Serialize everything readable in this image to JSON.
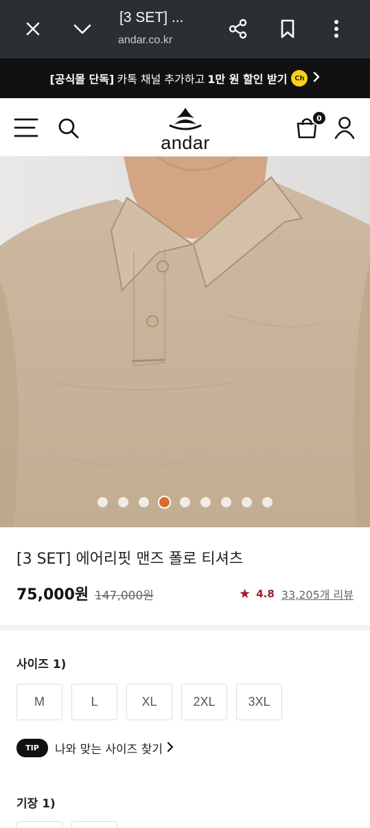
{
  "browser": {
    "title": "[3 SET] ...",
    "url": "andar.co.kr"
  },
  "promo": {
    "bold_prefix": "[공식몰 단독]",
    "normal_text": "카톡 채널 추가하고",
    "bold_suffix": "1만 원 할인 받기",
    "badge": "Ch"
  },
  "header": {
    "logo_text": "andar",
    "cart_count": "0"
  },
  "carousel": {
    "total": 9,
    "active_index": 3
  },
  "product": {
    "title": "[3 SET] 에어리핏 맨즈 폴로 티셔츠",
    "price": "75,000원",
    "original_price": "147,000원",
    "rating": "4.8",
    "reviews": "33,205개 리뷰"
  },
  "options": {
    "size_label": "사이즈 1)",
    "sizes": [
      "M",
      "L",
      "XL",
      "2XL",
      "3XL"
    ],
    "tip_badge": "TIP",
    "tip_text": "나와 맞는 사이즈 찾기",
    "length_label": "기장 1)"
  },
  "colors": {
    "browser_bar": "#2b2f33",
    "promo_bg": "#111111",
    "accent_red": "#a3182c",
    "active_dot": "#d96b32",
    "shirt": "#c9b59d"
  }
}
